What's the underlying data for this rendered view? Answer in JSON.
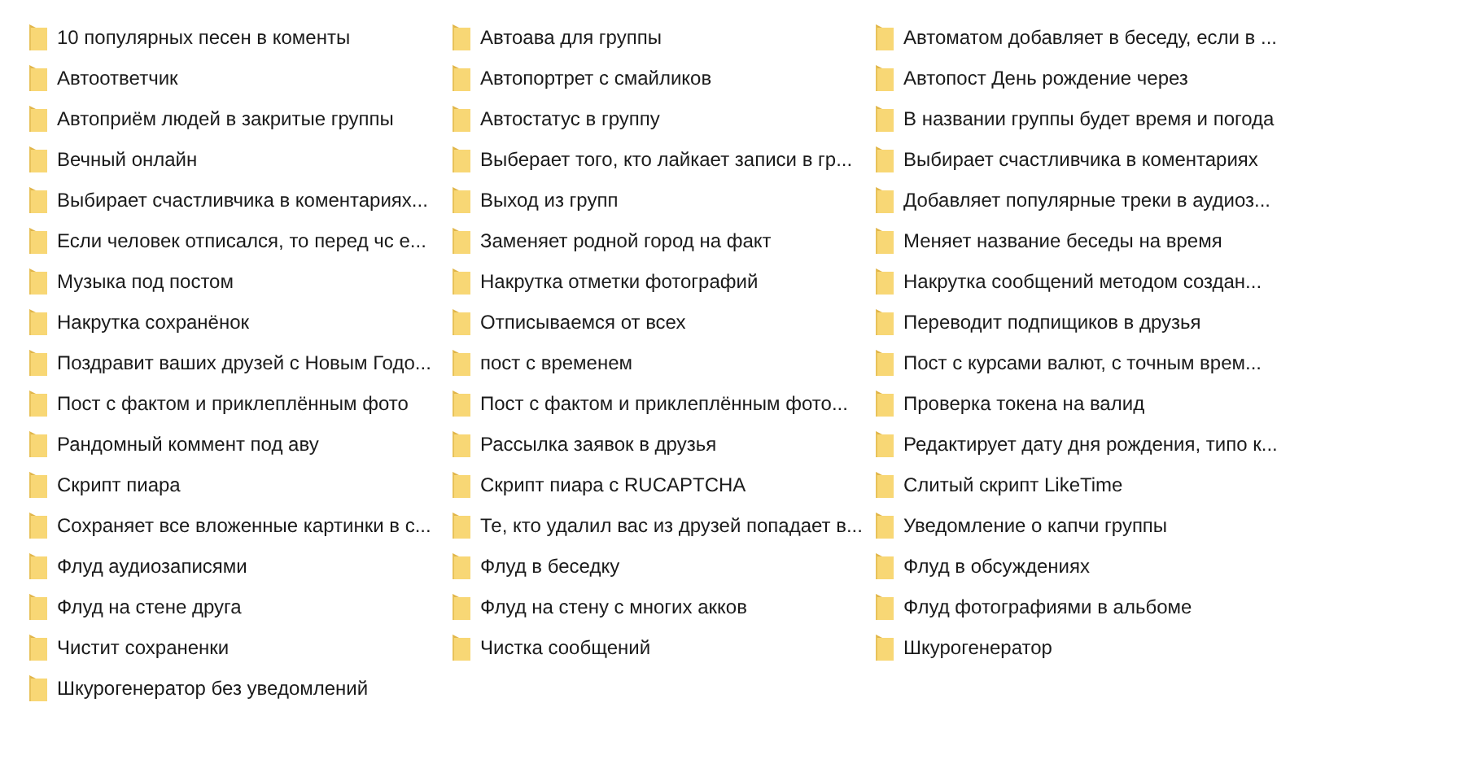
{
  "items": [
    {
      "name": "10 популярных песен в коменты"
    },
    {
      "name": "Автоава для группы"
    },
    {
      "name": "Автоматом добавляет в беседу, если в ..."
    },
    {
      "name": "Автоответчик"
    },
    {
      "name": "Автопортрет с смайликов"
    },
    {
      "name": "Автопост День рождение через"
    },
    {
      "name": "Автоприём людей в закритые группы"
    },
    {
      "name": "Автостатус в группу"
    },
    {
      "name": "В названии группы будет время и погода"
    },
    {
      "name": "Вечный онлайн"
    },
    {
      "name": "Выберает того, кто лайкает записи в гр..."
    },
    {
      "name": "Выбирает счастливчика в коментариях"
    },
    {
      "name": "Выбирает счастливчика в коментариях..."
    },
    {
      "name": "Выход из групп"
    },
    {
      "name": "Добавляет популярные треки в аудиоз..."
    },
    {
      "name": "Если человек отписался, то перед чс е..."
    },
    {
      "name": "Заменяет родной город на факт"
    },
    {
      "name": "Меняет название беседы на время"
    },
    {
      "name": "Музыка под постом"
    },
    {
      "name": "Накрутка отметки фотографий"
    },
    {
      "name": "Накрутка сообщений методом создан..."
    },
    {
      "name": "Накрутка сохранёнок"
    },
    {
      "name": "Отписываемся от всех"
    },
    {
      "name": "Переводит подпищиков в друзья"
    },
    {
      "name": "Поздравит ваших друзей с Новым Годо..."
    },
    {
      "name": "пост с временем"
    },
    {
      "name": "Пост с курсами валют, с точным врем..."
    },
    {
      "name": "Пост с фактом и приклеплённым фото"
    },
    {
      "name": "Пост с фактом и приклеплённым фото..."
    },
    {
      "name": "Проверка токена на валид"
    },
    {
      "name": "Рандомный коммент под аву"
    },
    {
      "name": "Рассылка заявок в друзья"
    },
    {
      "name": "Редактирует дату дня рождения, типо к..."
    },
    {
      "name": "Скрипт пиара"
    },
    {
      "name": "Скрипт пиара с RUCAPTCHA"
    },
    {
      "name": "Слитый скрипт LikeTime"
    },
    {
      "name": "Сохраняет все вложенные картинки в с..."
    },
    {
      "name": "Те, кто удалил вас из друзей попадает в..."
    },
    {
      "name": "Уведомление о капчи группы"
    },
    {
      "name": "Флуд аудиозаписями"
    },
    {
      "name": "Флуд в беседку"
    },
    {
      "name": "Флуд в обсуждениях"
    },
    {
      "name": "Флуд на стене друга"
    },
    {
      "name": "Флуд на стену с многих акков"
    },
    {
      "name": "Флуд фотографиями в альбоме"
    },
    {
      "name": "Чистит сохраненки"
    },
    {
      "name": "Чистка сообщений"
    },
    {
      "name": "Шкурогенератор"
    },
    {
      "name": "Шкурогенератор без уведомлений"
    }
  ]
}
